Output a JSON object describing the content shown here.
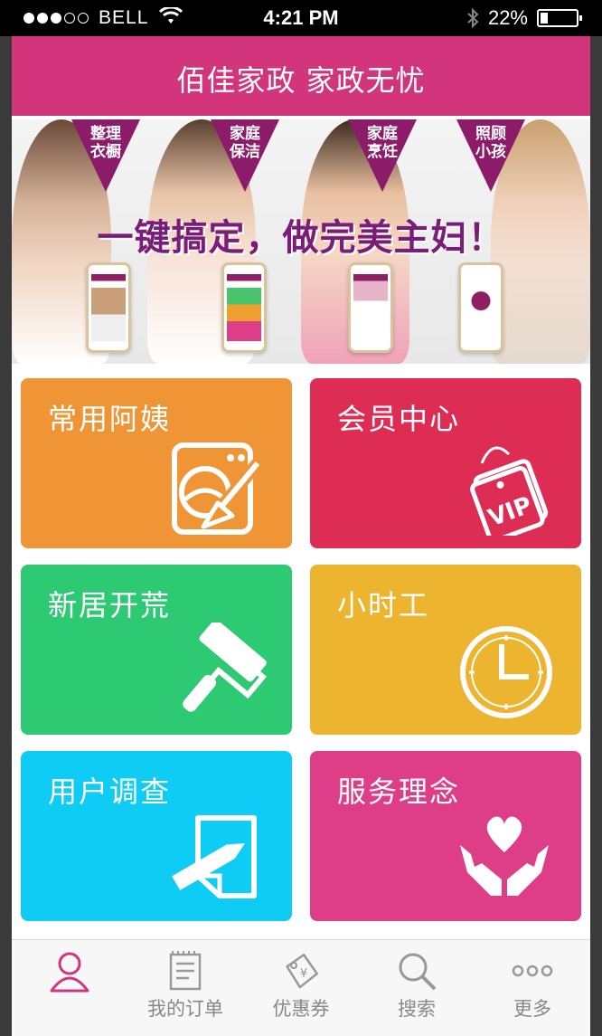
{
  "status_bar": {
    "carrier": "BELL",
    "time": "4:21 PM",
    "battery": "22%"
  },
  "header": {
    "title": "佰佳家政 家政无忧"
  },
  "banner": {
    "slogan": "一键搞定，做完美主妇！",
    "tags": [
      {
        "line1": "整理",
        "line2": "衣橱"
      },
      {
        "line1": "家庭",
        "line2": "保洁"
      },
      {
        "line1": "家庭",
        "line2": "烹饪"
      },
      {
        "line1": "照顾",
        "line2": "小孩"
      }
    ]
  },
  "tiles": [
    {
      "label": "常用阿姨",
      "color": "#F09535",
      "icon": "washing-machine-icon"
    },
    {
      "label": "会员中心",
      "color": "#DE2D54",
      "icon": "vip-card-icon"
    },
    {
      "label": "新居开荒",
      "color": "#2ECA73",
      "icon": "paint-roller-icon"
    },
    {
      "label": "小时工",
      "color": "#EDB42F",
      "icon": "clock-icon"
    },
    {
      "label": "用户调查",
      "color": "#0FCCF4",
      "icon": "survey-pencil-icon"
    },
    {
      "label": "服务理念",
      "color": "#DE3E87",
      "icon": "hands-heart-icon"
    }
  ],
  "tabbar": {
    "items": [
      {
        "label": "",
        "icon": "user-icon",
        "active": true
      },
      {
        "label": "我的订单",
        "icon": "order-list-icon",
        "active": false
      },
      {
        "label": "优惠券",
        "icon": "coupon-icon",
        "active": false
      },
      {
        "label": "搜索",
        "icon": "search-icon",
        "active": false
      },
      {
        "label": "更多",
        "icon": "more-icon",
        "active": false
      }
    ]
  },
  "colors": {
    "brand": "#D2357C",
    "tab_active": "#D2357C",
    "tab_inactive": "#888888"
  }
}
